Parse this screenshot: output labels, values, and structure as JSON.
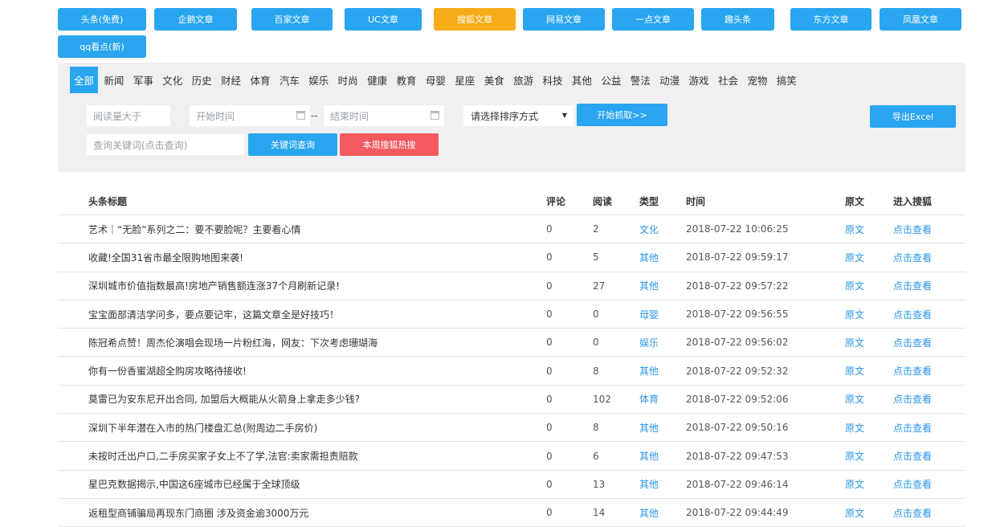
{
  "source_tabs": [
    {
      "label": "头条(免费)"
    },
    {
      "label": "企鹅文章"
    },
    {
      "label": "百家文章"
    },
    {
      "label": "UC文章"
    },
    {
      "label": "搜狐文章"
    },
    {
      "label": "网易文章"
    },
    {
      "label": "一点文章"
    },
    {
      "label": "趣头条"
    },
    {
      "label": "东方文章"
    },
    {
      "label": "凤凰文章"
    },
    {
      "label": "qq看点(新)"
    }
  ],
  "active_source": "搜狐文章",
  "categories": [
    "全部",
    "新闻",
    "军事",
    "文化",
    "历史",
    "财经",
    "体育",
    "汽车",
    "娱乐",
    "时尚",
    "健康",
    "教育",
    "母婴",
    "星座",
    "美食",
    "旅游",
    "科技",
    "其他",
    "公益",
    "警法",
    "动漫",
    "游戏",
    "社会",
    "宠物",
    "搞笑"
  ],
  "active_category": "全部",
  "filters": {
    "read_placeholder": "阅读量大于",
    "start_placeholder": "开始时间",
    "range_dash": "--",
    "end_placeholder": "结束时间",
    "sort_label": "请选择排序方式",
    "fetch_button": "开始抓取>>",
    "export_button": "导出Excel",
    "keyword_placeholder": "查询关键词(点击查询)",
    "keyword_button": "关键词查询",
    "hot_button": "本周搜狐热搜"
  },
  "colors": {
    "primary": "#2aa5f0",
    "active": "#f6ac19",
    "hot": "#f25a5f",
    "link": "#2a95e8"
  },
  "table": {
    "headers": {
      "title": "头条标题",
      "comments": "评论",
      "reads": "阅读",
      "type": "类型",
      "time": "时间",
      "source": "原文",
      "go": "进入搜狐"
    },
    "rows": [
      {
        "title": "艺术｜“无脸”系列之二：要不要脸呢？主要看心情",
        "comments": "0",
        "reads": "2",
        "type": "文化",
        "time": "2018-07-22 10:06:25",
        "source": "原文",
        "go": "点击查看"
      },
      {
        "title": "收藏!全国31省市最全限购地图来袭!",
        "comments": "0",
        "reads": "5",
        "type": "其他",
        "time": "2018-07-22 09:59:17",
        "source": "原文",
        "go": "点击查看"
      },
      {
        "title": "深圳城市价值指数最高!房地产销售额连涨37个月刷新记录!",
        "comments": "0",
        "reads": "27",
        "type": "其他",
        "time": "2018-07-22 09:57:22",
        "source": "原文",
        "go": "点击查看"
      },
      {
        "title": "宝宝面部清洁学问多，要点要记牢，这篇文章全是好技巧！",
        "comments": "0",
        "reads": "0",
        "type": "母婴",
        "time": "2018-07-22 09:56:55",
        "source": "原文",
        "go": "点击查看"
      },
      {
        "title": "陈冠希点赞！周杰伦演唱会现场一片粉红海，网友：下次考虑珊瑚海",
        "comments": "0",
        "reads": "0",
        "type": "娱乐",
        "time": "2018-07-22 09:56:02",
        "source": "原文",
        "go": "点击查看"
      },
      {
        "title": "你有一份香蜜湖超全购房攻略待接收!",
        "comments": "0",
        "reads": "8",
        "type": "其他",
        "time": "2018-07-22 09:52:32",
        "source": "原文",
        "go": "点击查看"
      },
      {
        "title": "莫雷已为安东尼开出合同, 加盟后大概能从火箭身上拿走多少钱?",
        "comments": "0",
        "reads": "102",
        "type": "体育",
        "time": "2018-07-22 09:52:06",
        "source": "原文",
        "go": "点击查看"
      },
      {
        "title": "深圳下半年潜在入市的热门楼盘汇总(附周边二手房价)",
        "comments": "0",
        "reads": "8",
        "type": "其他",
        "time": "2018-07-22 09:50:16",
        "source": "原文",
        "go": "点击查看"
      },
      {
        "title": "未按时迁出户口,二手房买家子女上不了学,法官:卖家需担责赔款",
        "comments": "0",
        "reads": "6",
        "type": "其他",
        "time": "2018-07-22 09:47:53",
        "source": "原文",
        "go": "点击查看"
      },
      {
        "title": "星巴克数据揭示,中国这6座城市已经属于全球顶级",
        "comments": "0",
        "reads": "13",
        "type": "其他",
        "time": "2018-07-22 09:46:14",
        "source": "原文",
        "go": "点击查看"
      },
      {
        "title": "返租型商铺骗局再现东门商圈 涉及资金逾3000万元",
        "comments": "0",
        "reads": "14",
        "type": "其他",
        "time": "2018-07-22 09:44:49",
        "source": "原文",
        "go": "点击查看"
      }
    ]
  }
}
